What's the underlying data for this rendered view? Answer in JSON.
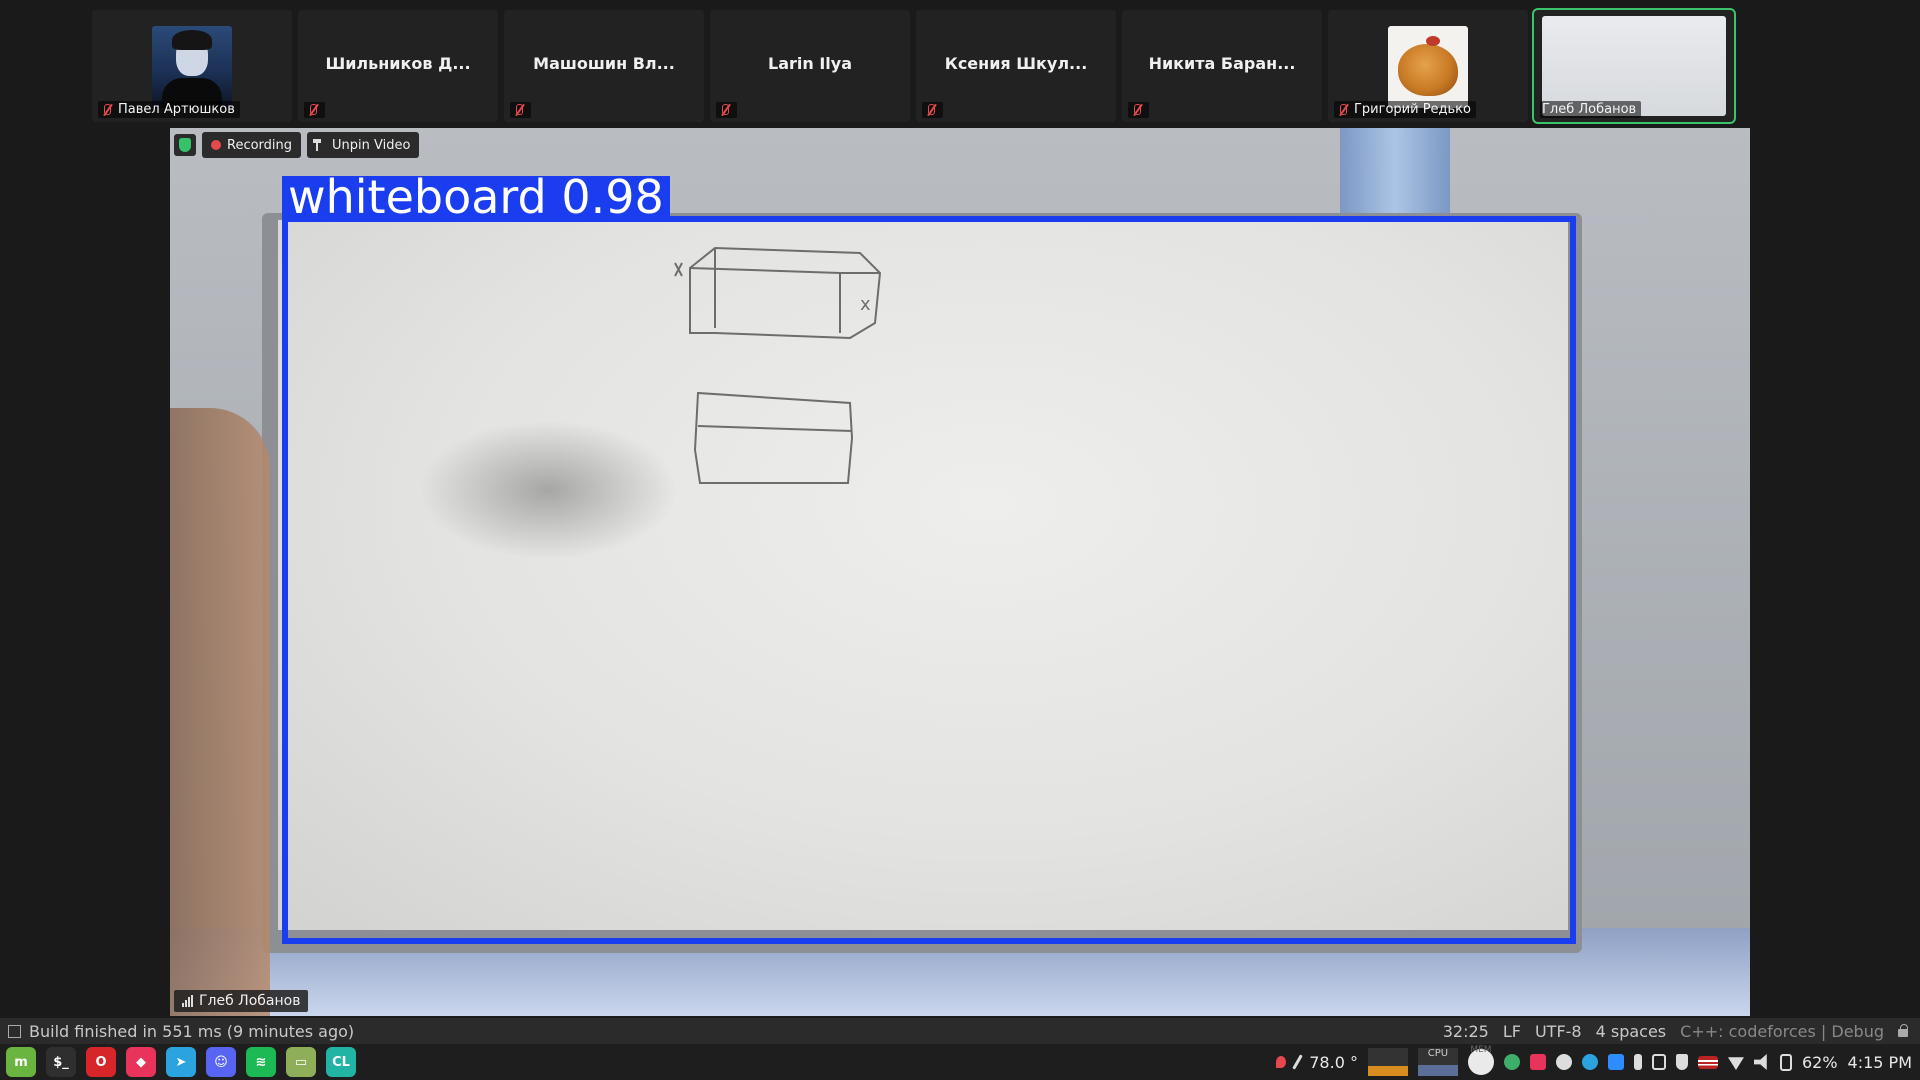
{
  "participants": [
    {
      "name": "Павел Артюшков",
      "type": "avatar-person"
    },
    {
      "name": "Шильников Д...",
      "type": "name-only"
    },
    {
      "name": "Машошин Вл...",
      "type": "name-only"
    },
    {
      "name": "Larin Ilya",
      "type": "name-only"
    },
    {
      "name": "Ксения Шкул...",
      "type": "name-only"
    },
    {
      "name": "Никита Баран...",
      "type": "name-only"
    },
    {
      "name": "Григорий Редько",
      "type": "avatar-hen"
    },
    {
      "name": "Глеб Лобанов",
      "type": "video-thumb",
      "active": true
    }
  ],
  "meeting": {
    "recording_label": "Recording",
    "unpin_label": "Unpin Video",
    "speaker_name": "Глеб Лобанов"
  },
  "detection": {
    "label": "whiteboard 0.98",
    "color": "#1a3df0"
  },
  "ide_status": {
    "build_message": "Build finished in 551 ms (9 minutes ago)",
    "cursor_position": "32:25",
    "line_ending": "LF",
    "encoding": "UTF-8",
    "indent": "4 spaces",
    "context": "C++: codeforces | Debug"
  },
  "taskbar": {
    "apps": [
      {
        "name": "mint-menu-icon",
        "glyph": "m",
        "color": "#69b53f"
      },
      {
        "name": "terminal-icon",
        "glyph": "$_",
        "color": "#2f2f2f"
      },
      {
        "name": "opera-icon",
        "glyph": "O",
        "color": "#d7262a"
      },
      {
        "name": "jetbrains-toolbox-icon",
        "glyph": "◆",
        "color": "#e8345a"
      },
      {
        "name": "telegram-icon",
        "glyph": "➤",
        "color": "#2aa3df"
      },
      {
        "name": "discord-icon",
        "glyph": "☺",
        "color": "#5865f2"
      },
      {
        "name": "spotify-icon",
        "glyph": "≋",
        "color": "#1db954"
      },
      {
        "name": "files-icon",
        "glyph": "▭",
        "color": "#8fae59"
      },
      {
        "name": "clion-icon",
        "glyph": "CL",
        "color": "#21b3a4"
      }
    ],
    "temperature": "78.0 °",
    "cpu_label": "CPU",
    "mem_label": "MEM",
    "battery": "62%",
    "time": "4:15 PM"
  }
}
